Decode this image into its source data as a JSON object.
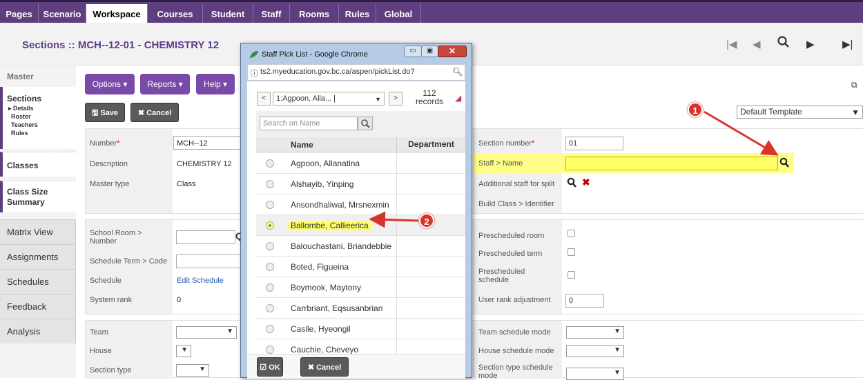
{
  "nav": {
    "tabs": [
      "Pages",
      "Scenario",
      "Workspace",
      "Courses",
      "Student",
      "Staff",
      "Rooms",
      "Rules",
      "Global"
    ],
    "active": "Workspace"
  },
  "page": {
    "title": "Sections :: MCH--12-01 - CHEMISTRY 12"
  },
  "sidebar": {
    "master": "Master",
    "sections": "Sections",
    "sub_items": [
      "▸ Details",
      "Roster",
      "Teachers",
      "Rules"
    ],
    "classes": "Classes",
    "class_size": "Class Size Summary",
    "tabs": [
      "Matrix View",
      "Assignments",
      "Schedules",
      "Feedback",
      "Analysis"
    ]
  },
  "toolbar": {
    "options": "Options ▾",
    "reports": "Reports ▾",
    "help": "Help ▾",
    "save": "Save",
    "cancel": "Cancel"
  },
  "template": {
    "label": "Default Template"
  },
  "form_left": {
    "number_label": "Number",
    "number_value": "MCH--12",
    "description_label": "Description",
    "description_value": "CHEMISTRY 12",
    "master_type_label": "Master type",
    "master_type_value": "Class",
    "school_room_label": "School Room > Number",
    "schedule_term_label": "Schedule Term > Code",
    "schedule_label": "Schedule",
    "schedule_link": "Edit Schedule",
    "system_rank_label": "System rank",
    "system_rank_value": "0",
    "team_label": "Team",
    "house_label": "House",
    "section_type_label": "Section type"
  },
  "form_right": {
    "section_number_label": "Section number",
    "section_number_value": "01",
    "staff_name_label": "Staff > Name",
    "additional_staff_label": "Additional staff for split",
    "build_class_label": "Build Class > Identifier",
    "prescheduled_room_label": "Prescheduled room",
    "prescheduled_term_label": "Prescheduled term",
    "prescheduled_schedule_label": "Prescheduled schedule",
    "user_rank_label": "User rank adjustment",
    "user_rank_value": "0",
    "team_mode_label": "Team schedule mode",
    "house_mode_label": "House schedule mode",
    "section_type_mode_label": "Section type schedule mode"
  },
  "popup": {
    "window_title": "Staff Pick List - Google Chrome",
    "url": "ts2.myeducation.gov.bc.ca/aspen/pickList.do?",
    "selector": "1:Agpoon, Alla... |",
    "records_count": "112",
    "records_label": "records",
    "search_placeholder": "Search on Name",
    "col_name": "Name",
    "col_department": "Department",
    "rows": [
      "Agpoon, Allanatina",
      "Alshayib, Yinping",
      "Ansondhaliwal, Mrsnexmin",
      "Ballombe, Callieerica",
      "Balouchastani, Briandebbie",
      "Boted, Figueina",
      "Boymook, Maytony",
      "Carrbriant, Eqsusanbrian",
      "Caslle, Hyeongil",
      "Cauchie, Cheveyo"
    ],
    "selected_index": 3,
    "ok": "OK",
    "cancel": "Cancel"
  },
  "annotations": {
    "one": "1",
    "two": "2"
  },
  "colors": {
    "nav": "#5e3e7e",
    "purple_button": "#7a4aa8",
    "highlight": "#ffff66",
    "annotation": "#d9342b"
  }
}
